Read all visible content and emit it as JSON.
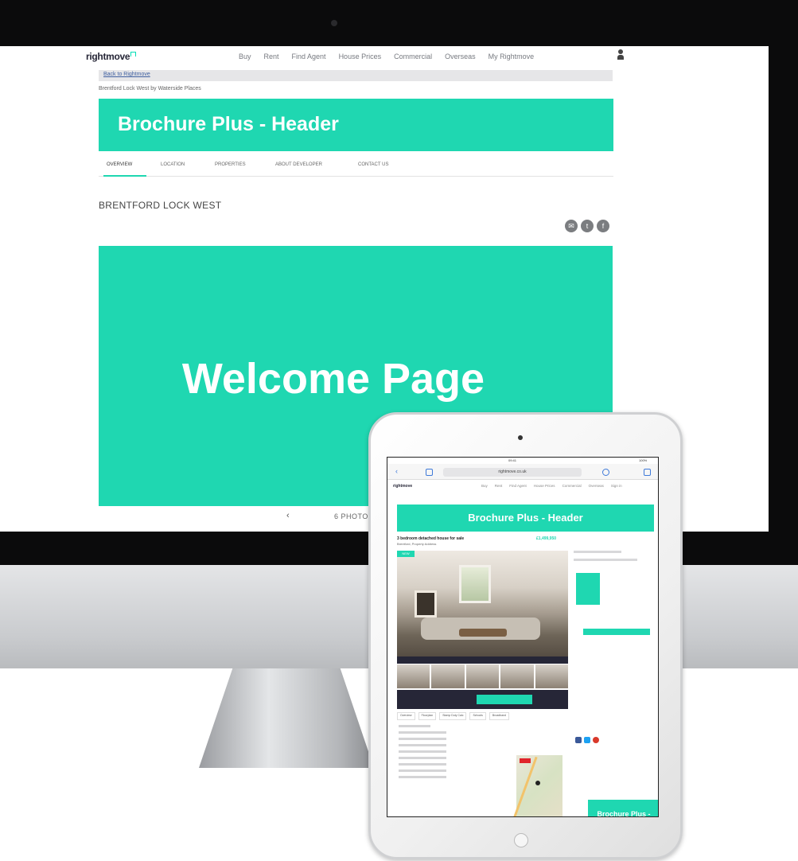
{
  "colors": {
    "accent": "#1fd7b1",
    "dark_navy": "#262637",
    "frame_black": "#0b0b0c",
    "share_grey": "#7b7d80"
  },
  "desktop": {
    "site": {
      "logo": "rightmove",
      "nav_items": [
        "Buy",
        "Rent",
        "Find Agent",
        "House Prices",
        "Commercial",
        "Overseas",
        "My Rightmove"
      ],
      "user_icon": "user-icon"
    },
    "back_link": "Back to Rightmove",
    "breadcrumb": "Brentford Lock West by Waterside Places",
    "header_title": "Brochure Plus - Header",
    "tabs": [
      "OVERVIEW",
      "LOCATION",
      "PROPERTIES",
      "ABOUT DEVELOPER",
      "CONTACT US"
    ],
    "active_tab": "OVERVIEW",
    "development_title": "BRENTFORD LOCK WEST",
    "share_icons": [
      "email-icon",
      "twitter-icon",
      "facebook-icon"
    ],
    "hero_title": "Welcome Page",
    "photo_nav": "‹",
    "photo_count": "6 PHOTO"
  },
  "tablet": {
    "status_bar": {
      "time": "09:41",
      "battery": "100%"
    },
    "url": "rightmove.co.uk",
    "site": {
      "logo": "rightmove",
      "nav_items": [
        "Buy",
        "Rent",
        "Find Agent",
        "House Prices",
        "Commercial",
        "Overseas",
        "Sign in"
      ]
    },
    "header_title": "Brochure Plus - Header",
    "listing_title": "3 bedroom detached house for sale",
    "listing_sub": "Brentford, Property Address",
    "price": "£1,499,950",
    "new_tag": "NEW",
    "tabs": [
      "Overview",
      "Floorplan",
      "Stamp Duty Calc",
      "Schools",
      "Broadband"
    ],
    "mid_advert": "Brochure Plus - Mid Page Advert"
  }
}
